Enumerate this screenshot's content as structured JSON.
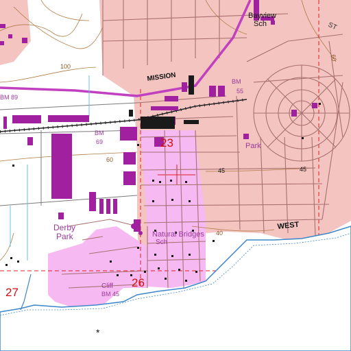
{
  "map": {
    "labels": {
      "bayview": "Bayview",
      "bayview_sch": "Sch",
      "st": "ST",
      "mission": "MISSION",
      "bm_55": "BM",
      "bm_55_num": "55",
      "bm_89": "BM 89",
      "bm_69": "BM",
      "bm_69_num": "69",
      "contour_100": "100",
      "contour_60_left": "60",
      "contour_60_right": "60",
      "contour_45_a": "45",
      "contour_45_b": "45",
      "contour_40": "40",
      "section_23": "23",
      "section_26": "26",
      "section_27": "27",
      "park": "Park",
      "derby": "Derby",
      "derby_park": "Park",
      "natural_bridges": "Natural Bridges",
      "natural_bridges_sch": "Sch",
      "west": "WEST",
      "cliff": "Cliff",
      "bm_45": "BM 45"
    },
    "colors": {
      "urban_tint": "#f3c4c0",
      "pink_area": "#f6b9f2",
      "building": "#a020a0",
      "black_building": "#1a1a1a",
      "road_line": "#a87070",
      "highway": "#c040c0",
      "water": "#3b85c8",
      "water_fill": "#ffffff",
      "contour": "#b07a40",
      "grid_red": "#e02020",
      "section_text": "#d01010",
      "label_text": "#5a2a5a",
      "cyan": "#68c0e0"
    }
  }
}
